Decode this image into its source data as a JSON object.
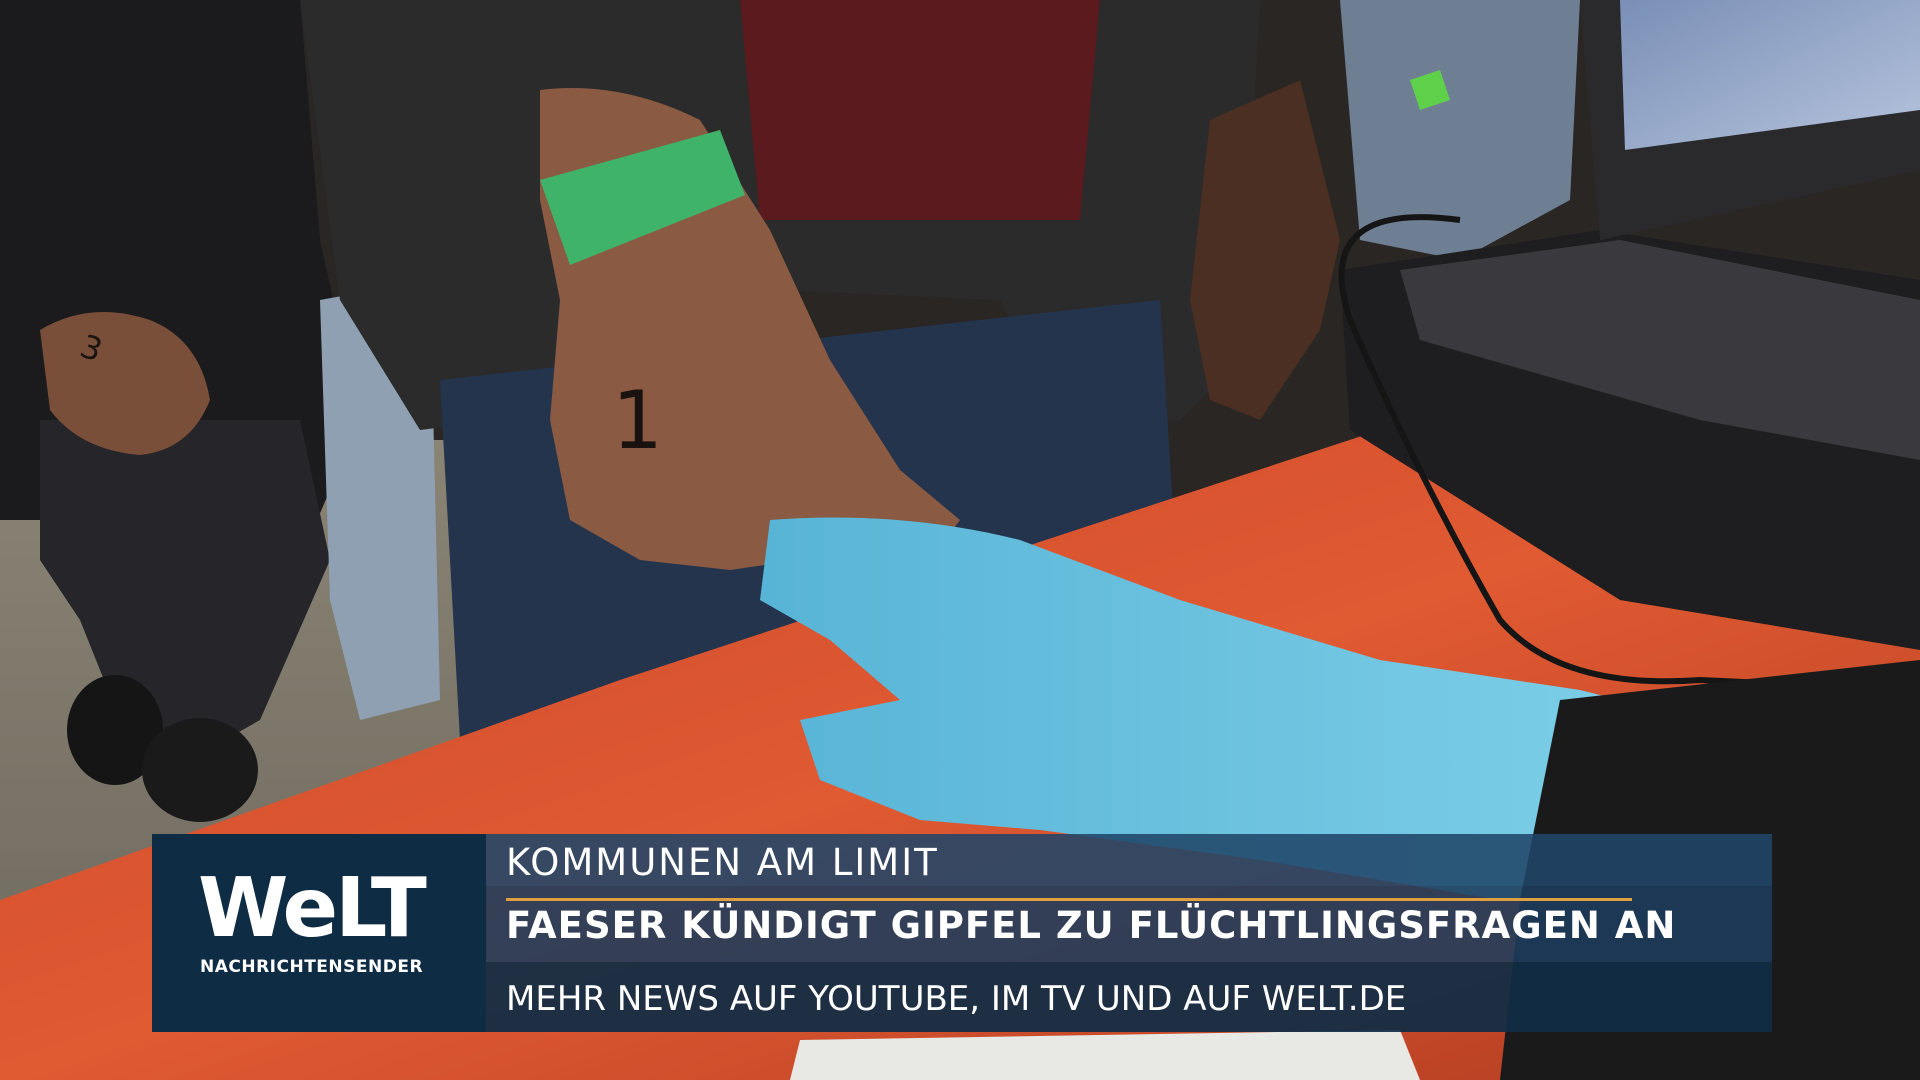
{
  "logo": {
    "wordmark": "WeLT",
    "subtitle": "NACHRICHTENSENDER"
  },
  "lower_third": {
    "kicker": "KOMMUNEN AM LIMIT",
    "headline": "FAESER KÜNDIGT GIPFEL ZU FLÜCHTLINGSFRAGEN AN",
    "footer": "MEHR NEWS AUF YOUTUBE, IM TV UND AUF WELT.DE"
  },
  "scene": {
    "hand_marking": "1",
    "background_hand_marking": "3"
  },
  "colors": {
    "banner_dark": "#0f2c45",
    "banner_mid": "#1c3c5c",
    "accent_line": "#e0a040",
    "glove": "#6ec3dd",
    "wristband": "#3fb36a",
    "table": "#d4512e"
  }
}
